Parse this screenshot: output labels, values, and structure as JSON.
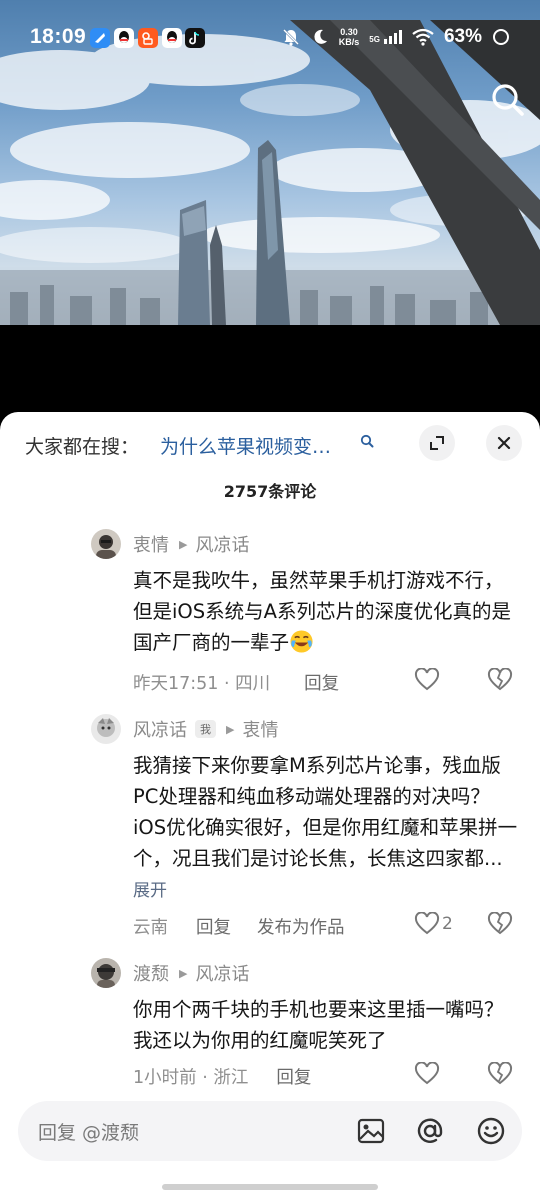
{
  "status_bar": {
    "time": "18:09",
    "net_speed_value": "0.30",
    "net_speed_unit": "KB/s",
    "signal_label": "5G",
    "battery": "63%",
    "apps": [
      {
        "icon": "feather-app-icon",
        "color": "#1e90ff"
      },
      {
        "icon": "qq-icon",
        "color": "#ffffff"
      },
      {
        "icon": "kuaishou-icon",
        "color": "#ff5a1f"
      },
      {
        "icon": "qq-icon",
        "color": "#ffffff"
      },
      {
        "icon": "tiktok-icon",
        "color": "#111111"
      }
    ]
  },
  "video": {
    "top_right_icon": "search-icon"
  },
  "sheet": {
    "hot_search_prefix": "大家都在搜：",
    "hot_search_query": "为什么苹果视频变…",
    "expand_icon": "expand-icon",
    "close_icon": "close-icon",
    "comment_count": "2757条评论"
  },
  "comments": [
    {
      "author": "衷情",
      "reply_to": "风凉话",
      "text": "真不是我吹牛，虽然苹果手机打游戏不行，但是iOS系统与A系列芯片的深度优化真的是国产厂商的一辈子",
      "time": "昨天17:51 · 四川",
      "reply_label": "回复",
      "like_count": ""
    },
    {
      "author": "风凉话",
      "me_tag": "我",
      "reply_to": "衷情",
      "text": "我猜接下来你要拿M系列芯片论事，残血版PC处理器和纯血移动端处理器的对决吗？iOS优化确实很好，但是你用红魔和苹果拼一个，况且我们是讨论长焦，长焦这四家都...",
      "expand_label": "展开",
      "time": "云南",
      "reply_label": "回复",
      "publish_label": "发布为作品",
      "like_count": "2"
    },
    {
      "author": "渡颓",
      "reply_to": "风凉话",
      "text": "你用个两千块的手机也要来这里插一嘴吗？我还以为你用的红魔呢笑死了",
      "time": "1小时前 · 浙江",
      "reply_label": "回复",
      "like_count": ""
    }
  ],
  "input": {
    "placeholder": "回复 @渡颓",
    "image_icon": "image-icon",
    "mention_icon": "at-icon",
    "emoji_icon": "emoji-icon"
  }
}
